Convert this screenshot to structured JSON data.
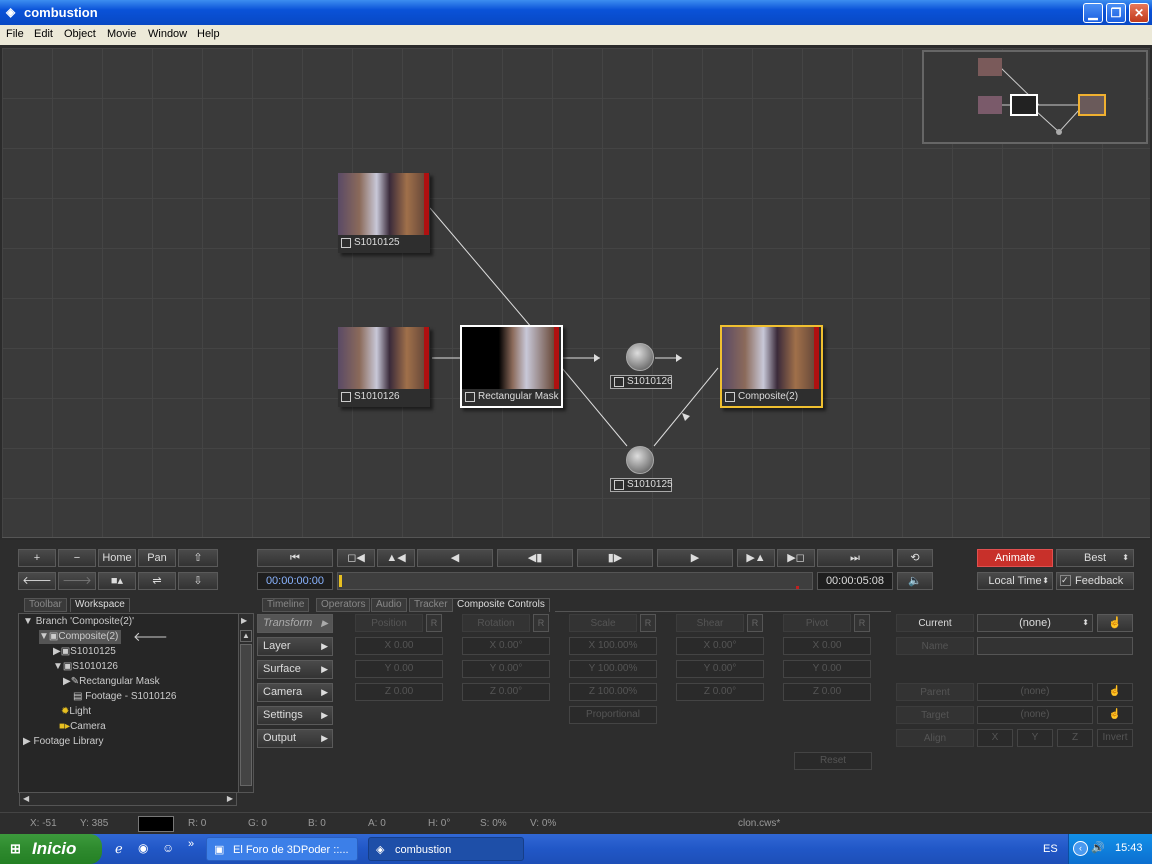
{
  "window": {
    "title": "combustion"
  },
  "menu": [
    "File",
    "Edit",
    "Object",
    "Movie",
    "Window",
    "Help"
  ],
  "nodes": {
    "s1010125_top": "S1010125",
    "s1010126_left": "S1010126",
    "mask": "Rectangular Mask",
    "op_s1010126": "S1010126",
    "op_s1010125": "S1010125",
    "composite": "Composite(2)"
  },
  "nav": {
    "plus": "+",
    "minus": "−",
    "home": "Home",
    "pan": "Pan"
  },
  "transport": {
    "start_time": "00:00:00:00",
    "end_time": "00:00:05:08"
  },
  "right_controls": {
    "animate": "Animate",
    "quality": "Best",
    "time_mode": "Local Time",
    "feedback": "Feedback"
  },
  "panel_tabs_left": [
    "Toolbar",
    "Workspace"
  ],
  "panel_tabs": [
    "Timeline",
    "Operators",
    "Audio",
    "Tracker",
    "Composite Controls"
  ],
  "tree": {
    "branch": "Branch 'Composite(2)'",
    "composite": "Composite(2)",
    "s1010125": "S1010125",
    "s1010126": "S1010126",
    "mask": "Rectangular Mask",
    "footage": "Footage - S1010126",
    "light": "Light",
    "camera": "Camera",
    "library": "Footage Library"
  },
  "side_buttons": [
    "Transform",
    "Layer",
    "Surface",
    "Camera",
    "Settings",
    "Output"
  ],
  "columns": [
    {
      "name": "Position",
      "x": "X 0.00",
      "y": "Y 0.00",
      "z": "Z 0.00"
    },
    {
      "name": "Rotation",
      "x": "X 0.00°",
      "y": "Y 0.00°",
      "z": "Z 0.00°"
    },
    {
      "name": "Scale",
      "x": "X 100.00%",
      "y": "Y 100.00%",
      "z": "Z 100.00%"
    },
    {
      "name": "Shear",
      "x": "X 0.00°",
      "y": "Y 0.00°",
      "z": "Z 0.00°"
    },
    {
      "name": "Pivot",
      "x": "X 0.00",
      "y": "Y 0.00",
      "z": "Z 0.00"
    }
  ],
  "r_label": "R",
  "proportional": "Proportional",
  "reset": "Reset",
  "props": {
    "current_label": "Current",
    "current_value": "(none)",
    "name_label": "Name",
    "parent_label": "Parent",
    "parent_value": "(none)",
    "target_label": "Target",
    "target_value": "(none)",
    "align_label": "Align",
    "align_x": "X",
    "align_y": "Y",
    "align_z": "Z",
    "invert": "Invert"
  },
  "status": {
    "x": "X:  -51",
    "y": "Y:  385",
    "r": "R: 0",
    "g": "G: 0",
    "b": "B: 0",
    "a": "A: 0",
    "h": "H: 0°",
    "s": "S: 0%",
    "v": "V: 0%",
    "file": "clon.cws*"
  },
  "taskbar": {
    "start": "Inicio",
    "task1": "El Foro de 3DPoder ::...",
    "task2": "combustion",
    "lang": "ES",
    "clock": "15:43"
  }
}
